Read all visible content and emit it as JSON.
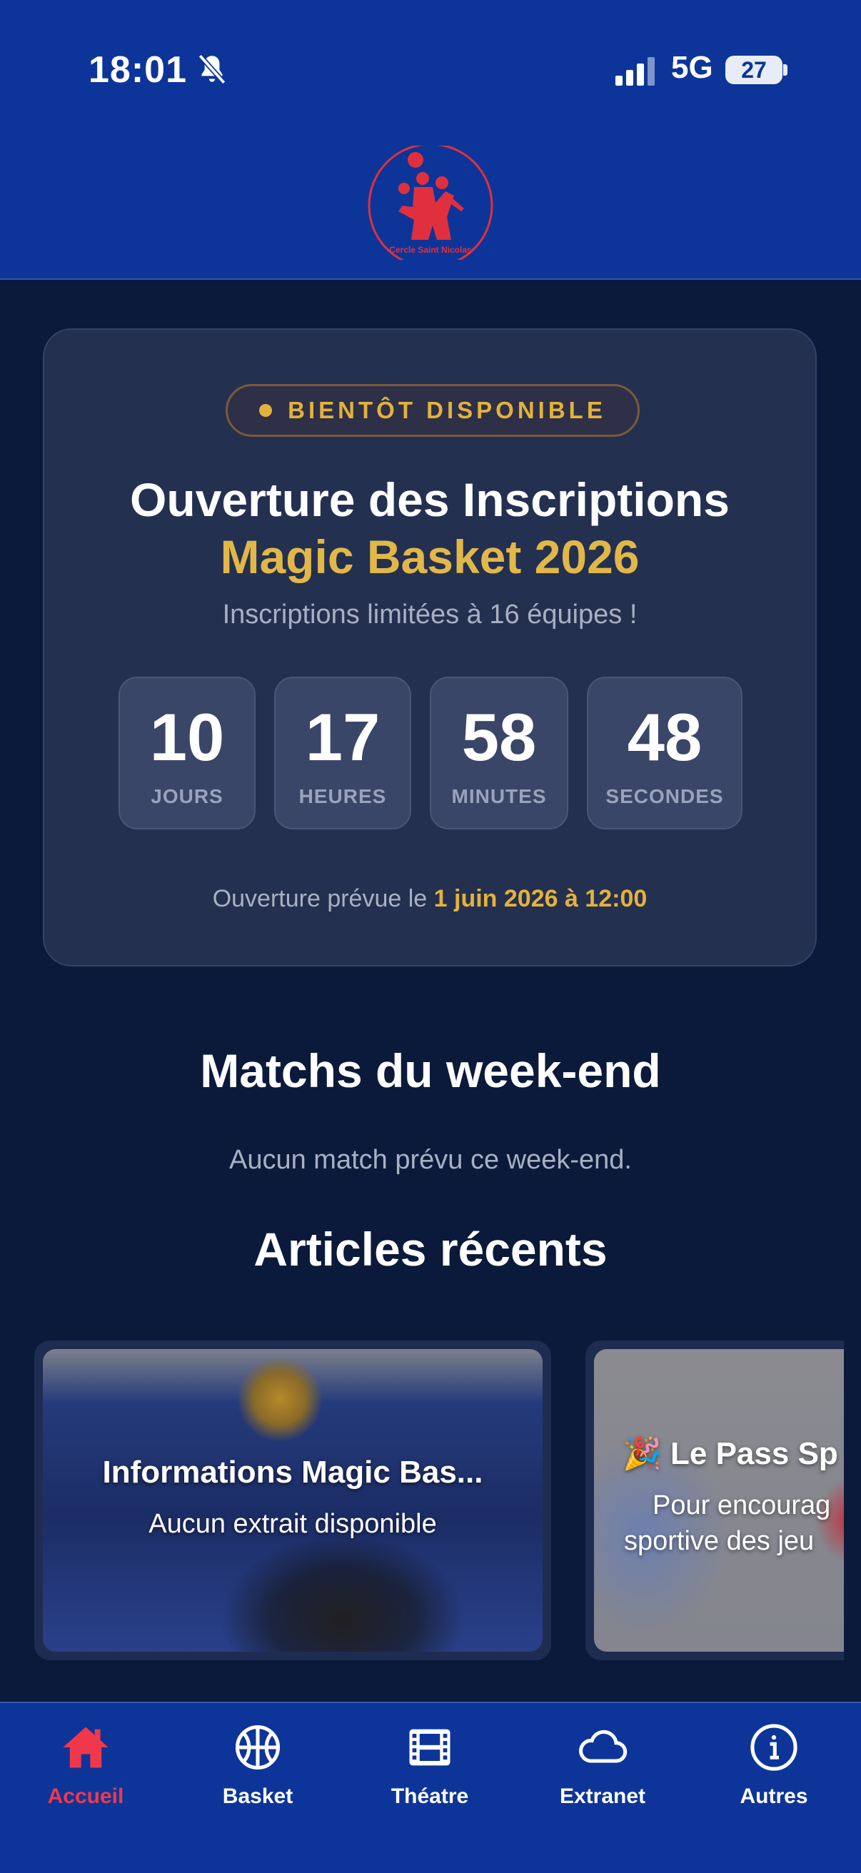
{
  "status_bar": {
    "time": "18:01",
    "network": "5G",
    "battery": "27"
  },
  "header": {
    "logo_text": "Cercle Saint Nicolas"
  },
  "countdown_card": {
    "badge": "BIENTÔT DISPONIBLE",
    "title": "Ouverture des Inscriptions",
    "subtitle": "Magic Basket 2026",
    "description": "Inscriptions limitées à 16 équipes !",
    "units": [
      {
        "value": "10",
        "label": "JOURS"
      },
      {
        "value": "17",
        "label": "HEURES"
      },
      {
        "value": "58",
        "label": "MINUTES"
      },
      {
        "value": "48",
        "label": "SECONDES"
      }
    ],
    "footer_prefix": "Ouverture prévue le ",
    "footer_date": "1 juin 2026 à 12:00"
  },
  "matches": {
    "title": "Matchs du week-end",
    "empty": "Aucun match prévu ce week-end."
  },
  "articles": {
    "title": "Articles récents",
    "items": [
      {
        "title": "Informations Magic Bas...",
        "excerpt": "Aucun extrait disponible"
      },
      {
        "title": "🎉 Le Pass Sp",
        "excerpt_line1": "Pour encourag",
        "excerpt_line2": "sportive des jeu"
      }
    ]
  },
  "bottom_nav": [
    {
      "label": "Accueil",
      "icon": "home-icon",
      "active": true
    },
    {
      "label": "Basket",
      "icon": "basketball-icon",
      "active": false
    },
    {
      "label": "Théatre",
      "icon": "film-icon",
      "active": false
    },
    {
      "label": "Extranet",
      "icon": "cloud-icon",
      "active": false
    },
    {
      "label": "Autres",
      "icon": "info-icon",
      "active": false
    }
  ],
  "colors": {
    "header_bg": "#0d3599",
    "page_bg": "#0b1a3a",
    "card_bg": "#243050",
    "accent_gold": "#e3b23c",
    "active_red": "#f0384a"
  }
}
